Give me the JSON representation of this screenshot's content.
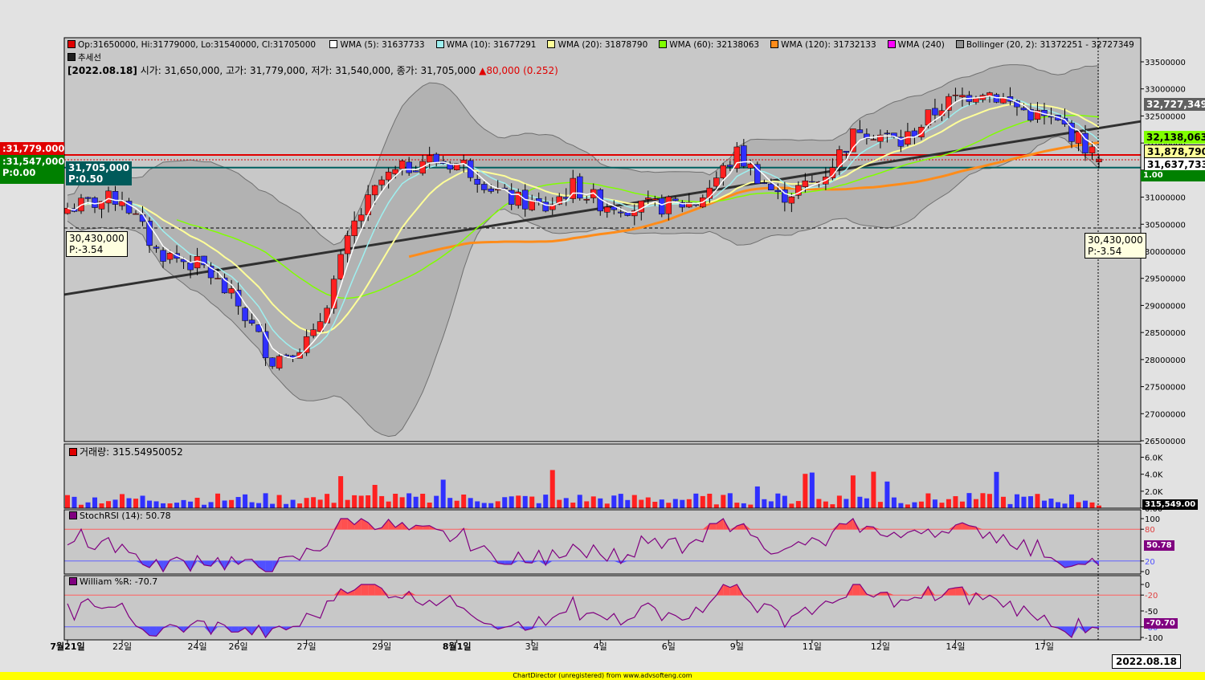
{
  "chart_data": {
    "type": "candlestick",
    "symbol_title": "추세선",
    "ohlc_legend": {
      "open": "Op:31650000",
      "high": "Hi:31779000",
      "low": "Lo:31540000",
      "close": "Cl:31705000"
    },
    "indicators": [
      {
        "name": "WMA (5): 31637733",
        "color": "#ffffff"
      },
      {
        "name": "WMA (10): 31677291",
        "color": "#9ef0f0"
      },
      {
        "name": "WMA (20): 31878790",
        "color": "#ffff99"
      },
      {
        "name": "WMA (60): 32138063",
        "color": "#80ff00"
      },
      {
        "name": "WMA (120): 31732133",
        "color": "#ff8c1a"
      },
      {
        "name": "WMA (240)",
        "color": "#ff00ff"
      },
      {
        "name": "Bollinger (20, 2): 31372251 - 32727349",
        "color": "#909090"
      }
    ],
    "info": {
      "date": "[2022.08.18]",
      "open": "시가: 31,650,000,",
      "high": "고가: 31,779,000,",
      "low": "저가: 31,540,000,",
      "close": "종가: 31,705,000",
      "change": "▲80,000 (0.252)"
    },
    "price_axis": {
      "min": 26500000,
      "max": 33500000,
      "ticks": [
        "33500000",
        "33000000",
        "32500000",
        "32000000",
        "31500000",
        "31000000",
        "30500000",
        "30000000",
        "29500000",
        "29000000",
        "28500000",
        "28000000",
        "27500000",
        "27000000",
        "26500000"
      ]
    },
    "x_labels": [
      {
        "label": "7월21일",
        "bold": true
      },
      {
        "label": "22일"
      },
      {
        "label": "24일"
      },
      {
        "label": "26일"
      },
      {
        "label": "27일"
      },
      {
        "label": "29일"
      },
      {
        "label": "8월1일",
        "bold": true
      },
      {
        "label": "3일"
      },
      {
        "label": "4일"
      },
      {
        "label": "6일"
      },
      {
        "label": "9일"
      },
      {
        "label": "11일"
      },
      {
        "label": "12일"
      },
      {
        "label": "14일"
      },
      {
        "label": "17일"
      }
    ],
    "price_tags": {
      "left_high": ":31,779.000",
      "left_mid": ":31,547,000",
      "left_pct": "P:0.00",
      "close": "31,705,000",
      "close_pct": "P:0.50",
      "bb_upper": "32,727,349",
      "wma60": "32,138,063",
      "wma20": "31,878,790",
      "wma5": "31,637,733",
      "wma10_cut": "1.00",
      "support_left": "30,430,000",
      "support_left_pct": "P:-3.54",
      "support_right": "30,430,000",
      "support_right_pct": "P:-3.54"
    },
    "levels": {
      "red": 31779000,
      "teal": 31547000,
      "support": 30430000
    },
    "volume": {
      "title": "거래량: 315.54950052",
      "ticks": [
        "6.0K",
        "4.0K",
        "2.0K",
        "0.00"
      ],
      "last_tag": "315,549.00"
    },
    "stochrsi": {
      "title": "StochRSI (14): 50.78",
      "ticks": [
        "100",
        "80",
        "20",
        "0"
      ],
      "last_tag": "50.78"
    },
    "williams": {
      "title": "William %R: -70.7",
      "ticks": [
        "0",
        "-20",
        "-50",
        "-80",
        "-100"
      ],
      "last_tag": "-70.70"
    }
  },
  "footer": "ChartDirector (unregistered) from www.advsofteng.com",
  "date_box": "2022.08.18"
}
